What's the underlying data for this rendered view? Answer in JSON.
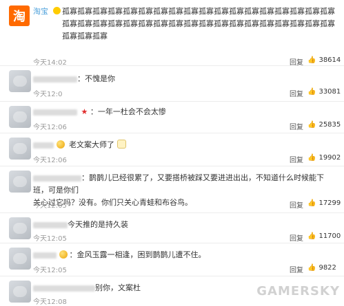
{
  "comments": [
    {
      "username": "淘宝",
      "avatar_text": "淘",
      "content": "孤寡孤寡孤寡孤寡孤寡孤寡孤寡孤寡孤寡孤寡孤寡孤寡孤寡孤寡孤寡孤寡孤寡孤寡孤寡孤寡孤寡孤寡孤寡孤寡孤寡孤寡孤寡孤寡孤寡孤寡孤寡孤寡孤寡孤寡孤寡孤寡孤寡孤寡孤寡",
      "time": "今天14:02",
      "reply": "回复",
      "likes": "38614"
    },
    {
      "content": "：不愧是你",
      "time": "今天12:0",
      "reply": "回复",
      "likes": "33081"
    },
    {
      "content": "：一年一杜会不会太惨",
      "time": "今天12:06",
      "reply": "回复",
      "likes": "25835"
    },
    {
      "content": "老文案大师了",
      "time": "今天12:06",
      "reply": "回复",
      "likes": "19902"
    },
    {
      "content_line1": "：鹊鹊儿已经很累了，又要搭桥被踩又要进进出出，不知道什么时候能下班，可是你们",
      "content_line2": "关心过它吗？没有。你们只关心青蛙和布谷鸟。",
      "time": "今天12:05",
      "reply": "回复",
      "likes": "17299"
    },
    {
      "content": "今天推的是持久装",
      "time": "今天12:05",
      "reply": "回复",
      "likes": "11700"
    },
    {
      "content": "：金风玉露一相逢，困到鹊鹊儿遭不住。",
      "time": "今天12:05",
      "reply": "回复",
      "likes": "9822"
    },
    {
      "content": "别你，文案杜",
      "time": "今天12:08",
      "reply": "",
      "likes": ""
    }
  ],
  "watermark": "GAMERSKY",
  "icons": {
    "like": "thumbs-up-icon",
    "verified": "verified-badge-icon"
  },
  "colors": {
    "username": "#eb7350",
    "text": "#333333",
    "muted": "#9a9a9a",
    "divider": "#ececec"
  }
}
